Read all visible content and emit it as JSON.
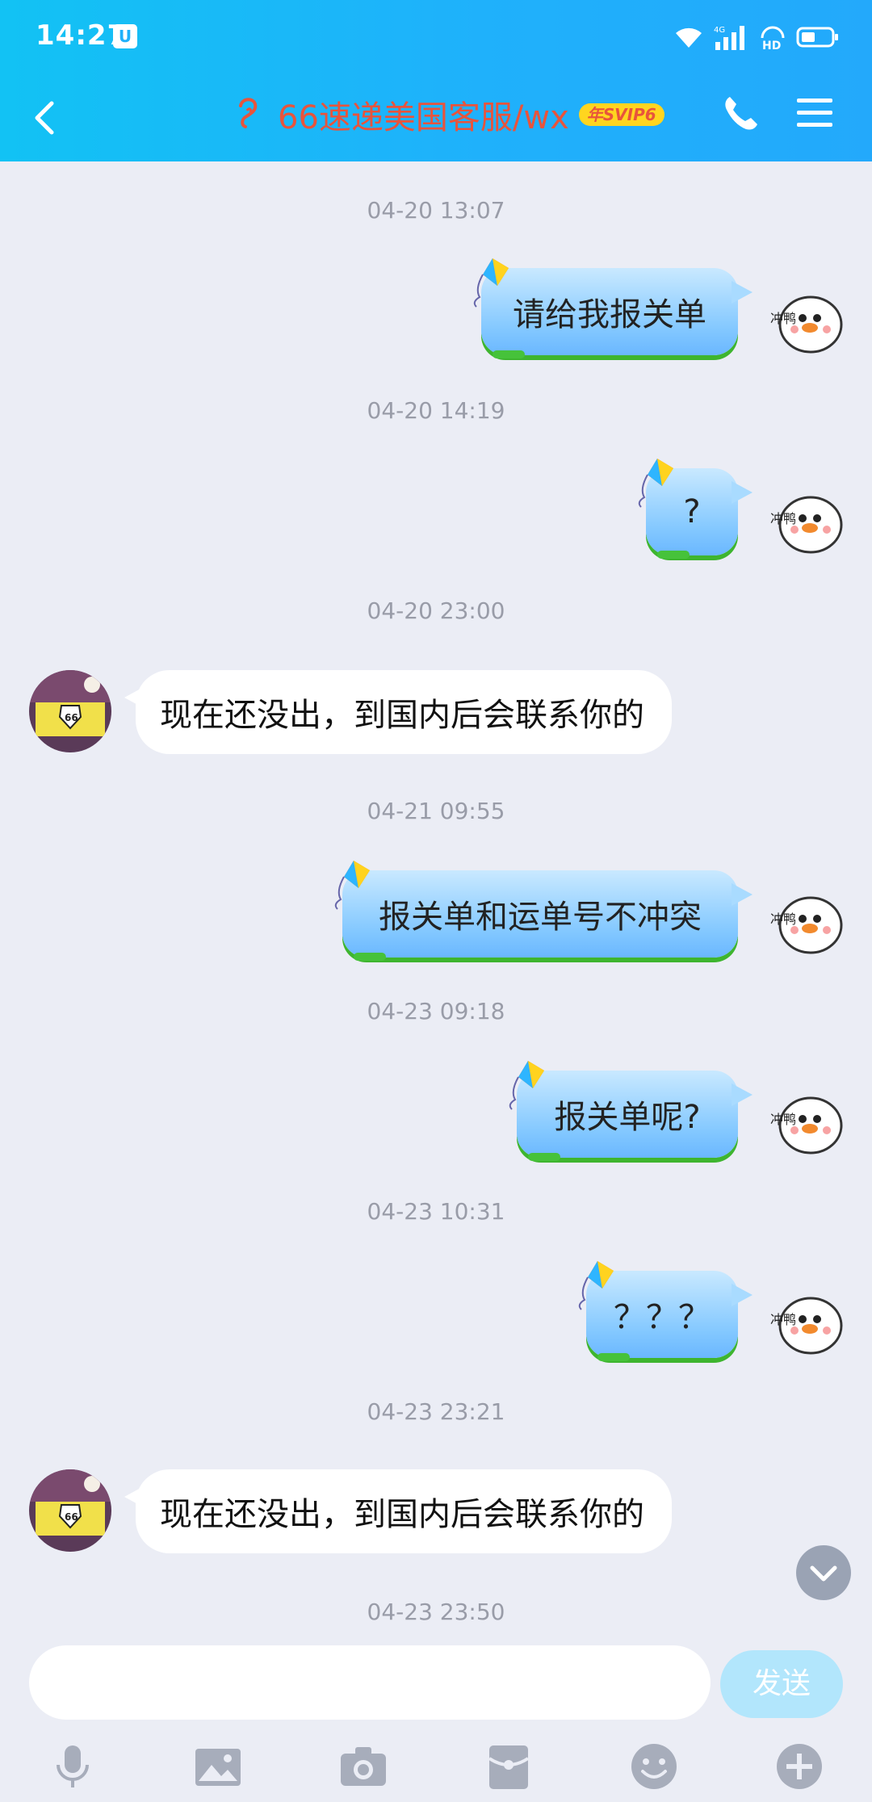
{
  "status_bar": {
    "time": "14:27",
    "app_icon": "shield-icon",
    "network": "4G",
    "hd": "HD"
  },
  "header": {
    "title": "66速递美国客服/wx",
    "badge": "年SVIP6",
    "icons": [
      "back-icon",
      "ear-icon",
      "phone-icon",
      "menu-icon"
    ]
  },
  "messages": [
    {
      "type": "timestamp",
      "text": "04-20 13:07"
    },
    {
      "type": "out",
      "text": "请给我报关单"
    },
    {
      "type": "timestamp",
      "text": "04-20 14:19"
    },
    {
      "type": "out",
      "text": "?"
    },
    {
      "type": "timestamp",
      "text": "04-20 23:00"
    },
    {
      "type": "in",
      "text": "现在还没出，到国内后会联系你的"
    },
    {
      "type": "timestamp",
      "text": "04-21 09:55"
    },
    {
      "type": "out",
      "text": "报关单和运单号不冲突"
    },
    {
      "type": "timestamp",
      "text": "04-23 09:18"
    },
    {
      "type": "out",
      "text": "报关单呢?"
    },
    {
      "type": "timestamp",
      "text": "04-23 10:31"
    },
    {
      "type": "out",
      "text": "？？？"
    },
    {
      "type": "timestamp",
      "text": "04-23 23:21"
    },
    {
      "type": "in",
      "text": "现在还没出，到国内后会联系你的"
    },
    {
      "type": "timestamp",
      "text": "04-23 23:50"
    }
  ],
  "duck_avatar_label": "冲鸭",
  "input": {
    "placeholder": "",
    "send_label": "发送"
  },
  "toolbar": [
    "microphone-icon",
    "image-icon",
    "camera-icon",
    "red-packet-icon",
    "emoji-icon",
    "plus-icon"
  ],
  "colors": {
    "header": "#1fb1fb",
    "title": "#e8543c",
    "badge": "#ffd51f",
    "background": "#ebedf5",
    "send_disabled": "#b2e6fc"
  }
}
